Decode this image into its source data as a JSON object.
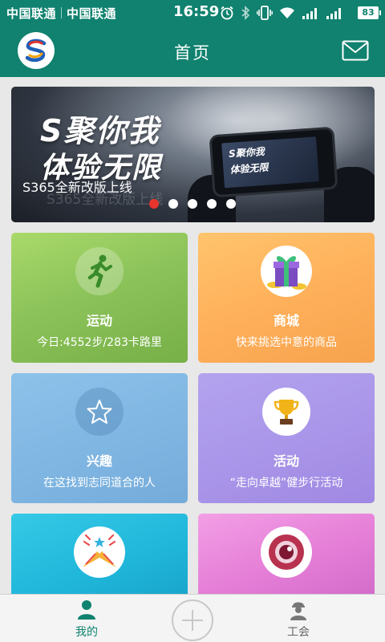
{
  "status_bar": {
    "carrier1": "中国联通",
    "carrier2": "中国联通",
    "time": "16:59",
    "battery": "83",
    "icons": [
      "alarm-icon",
      "bluetooth-icon",
      "vibrate-icon",
      "wifi-icon",
      "signal-icon",
      "signal-icon",
      "battery-icon"
    ]
  },
  "header": {
    "title": "首页",
    "logo_icon": "s365-logo-icon",
    "mail_icon": "mail-icon"
  },
  "banner": {
    "headline1": "S聚你我",
    "headline2": "体验无限",
    "phone_text1": "S聚你我",
    "phone_text2": "体验无限",
    "caption": "S365全新改版上线",
    "caption_ghost": "S365全新改版上线",
    "active_slide": 1,
    "slide_count": 5,
    "colors": {
      "active_dot": "#e8342c",
      "dot": "#ffffff"
    }
  },
  "tiles": [
    {
      "name": "运动",
      "subtitle": "今日:4552步/283卡路里",
      "icon": "runner-icon",
      "color": "#8cc35a"
    },
    {
      "name": "商城",
      "subtitle": "快来挑选中意的商品",
      "icon": "gift-box-icon",
      "color": "#ffb05a"
    },
    {
      "name": "兴趣",
      "subtitle": "在这找到志同道合的人",
      "icon": "star-icon",
      "color": "#7fb6e2"
    },
    {
      "name": "活动",
      "subtitle": "“走向卓越”健步行活动",
      "icon": "trophy-icon",
      "color": "#a995e9"
    },
    {
      "name": "",
      "subtitle": "",
      "icon": "party-horn-icon",
      "color": "#20b7db"
    },
    {
      "name": "",
      "subtitle": "",
      "icon": "eye-icon",
      "color": "#e57fd7"
    }
  ],
  "bottom_nav": {
    "me_label": "我的",
    "union_label": "工会",
    "active": "我的",
    "accent": "#10826f"
  },
  "theme": {
    "primary": "#10826f"
  }
}
